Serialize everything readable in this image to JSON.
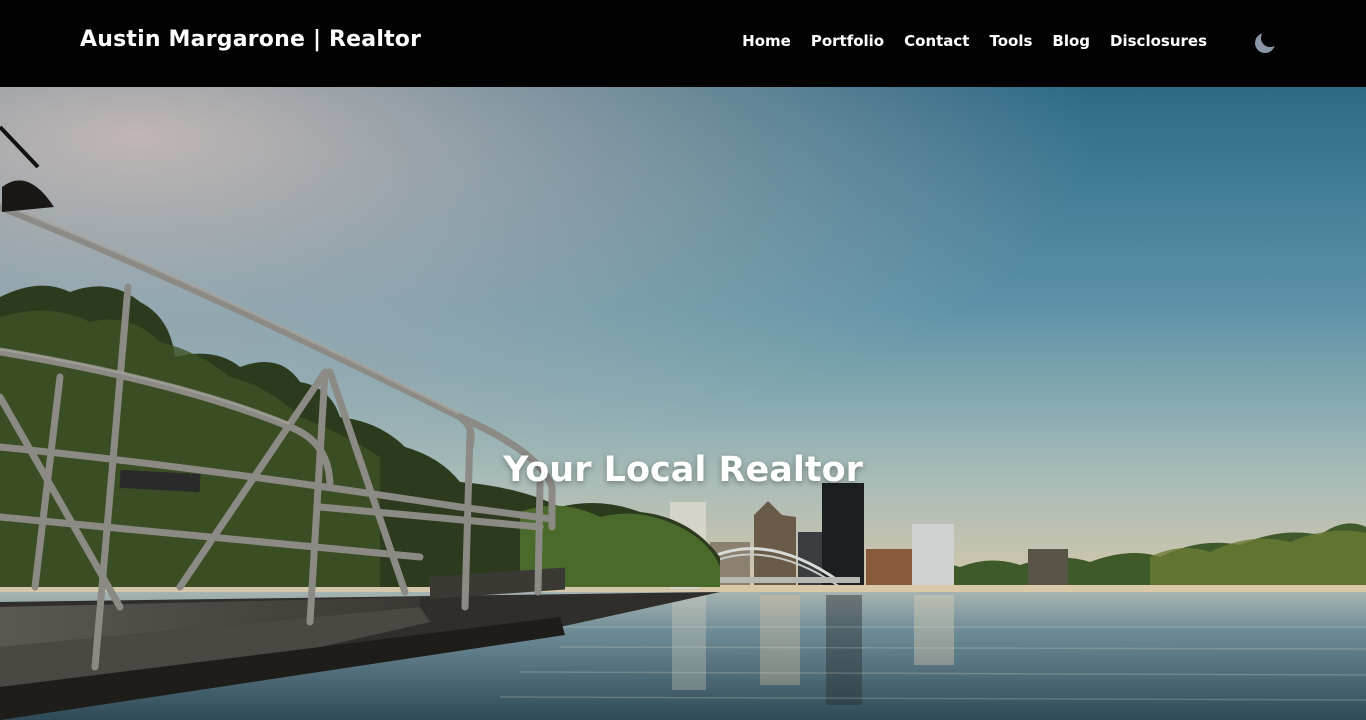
{
  "header": {
    "brand": "Austin Margarone | Realtor",
    "nav": [
      {
        "label": "Home"
      },
      {
        "label": "Portfolio"
      },
      {
        "label": "Contact"
      },
      {
        "label": "Tools"
      },
      {
        "label": "Blog"
      },
      {
        "label": "Disclosures"
      }
    ],
    "theme_toggle_icon": "moon-icon"
  },
  "hero": {
    "title": "Your Local Realtor",
    "image_subject": "city-skyline-over-river-with-dock-railing"
  },
  "colors": {
    "navbar_bg": "#030303",
    "nav_text": "#ffffff",
    "sky_top": "#2f6b86",
    "sky_horizon": "#e3c9a3",
    "water": "#5a7a88"
  }
}
